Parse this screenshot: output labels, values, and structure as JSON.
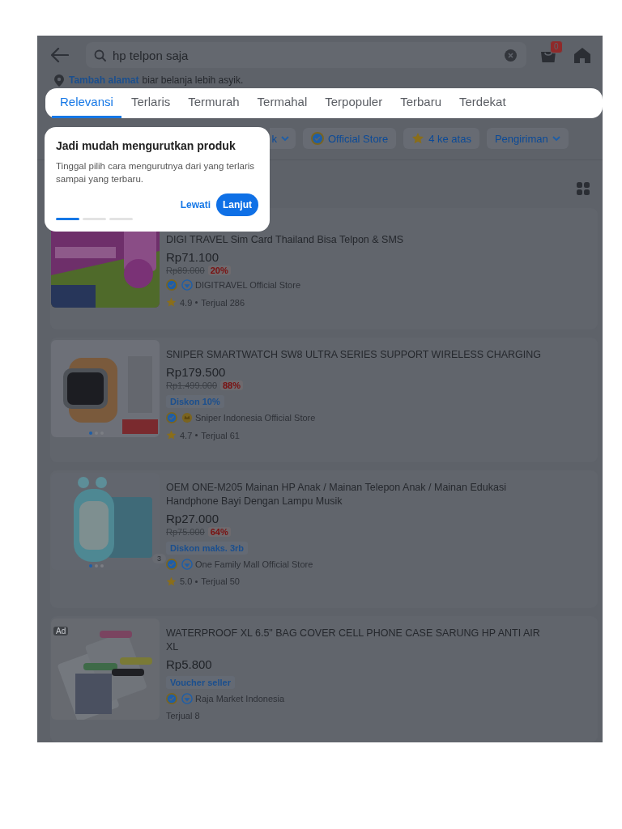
{
  "header": {
    "search": {
      "value": "hp telpon saja"
    },
    "cart_badge": "0"
  },
  "address": {
    "link": "Tambah alamat",
    "text": "biar belanja lebih asyik."
  },
  "sort_tabs": [
    {
      "label": "Relevansi",
      "selected": true
    },
    {
      "label": "Terlaris",
      "selected": false
    },
    {
      "label": "Termurah",
      "selected": false
    },
    {
      "label": "Termahal",
      "selected": false
    },
    {
      "label": "Terpopuler",
      "selected": false
    },
    {
      "label": "Terbaru",
      "selected": false
    },
    {
      "label": "Terdekat",
      "selected": false
    }
  ],
  "filters": [
    {
      "label": "k",
      "kind": "dropdown"
    },
    {
      "label": "Official Store",
      "kind": "badge"
    },
    {
      "label": "4 ke atas",
      "kind": "star"
    },
    {
      "label": "Pengiriman",
      "kind": "dropdown"
    }
  ],
  "coachmark": {
    "title": "Jadi mudah mengurutkan produk",
    "body": "Tinggal pilih cara mengurutnya dari yang terlaris sampai yang terbaru.",
    "skip": "Lewati",
    "next": "Lanjut",
    "steps": [
      {
        "selected": true
      },
      {
        "selected": false
      },
      {
        "selected": false
      }
    ]
  },
  "products": [
    {
      "title": "DIGI TRAVEL Sim Card Thailand Bisa Telpon & SMS",
      "price": "Rp71.100",
      "original_price": "Rp89.000",
      "discount": "20%",
      "store": {
        "kind": "mall",
        "name": "DIGITRAVEL Official Store"
      },
      "rating": "4.9",
      "sold": "Terjual 286",
      "carousel": false
    },
    {
      "title": "SNIPER SMARTWATCH SW8 ULTRA SERIES SUPPORT WIRELESS CHARGING",
      "price": "Rp179.500",
      "original_price": "Rp1.499.000",
      "discount": "88%",
      "promo": "Diskon 10%",
      "store": {
        "kind": "gold",
        "name": "Sniper Indonesia Official Store"
      },
      "rating": "4.7",
      "sold": "Terjual 61",
      "carousel": true
    },
    {
      "title": "OEM ONE-M205 Mainan HP Anak / Mainan Telepon Anak / Mainan Edukasi Handphone Bayi Dengan Lampu Musik",
      "price": "Rp27.000",
      "original_price": "Rp75.000",
      "discount": "64%",
      "promo": "Diskon maks. 3rb",
      "store": {
        "kind": "mall",
        "name": "One Family Mall Official Store"
      },
      "rating": "5.0",
      "sold": "Terjual 50",
      "carousel": true,
      "image_count": "3"
    },
    {
      "title": "WATERPROOF XL 6.5\" BAG COVER CELL PHONE CASE SARUNG HP ANTI AIR XL",
      "price": "Rp5.800",
      "promo": "Voucher seller",
      "store": {
        "kind": "mall",
        "name": "Raja Market Indonesia"
      },
      "sold": "Terjual 8",
      "carousel": false,
      "ad_label": "Ad"
    }
  ]
}
